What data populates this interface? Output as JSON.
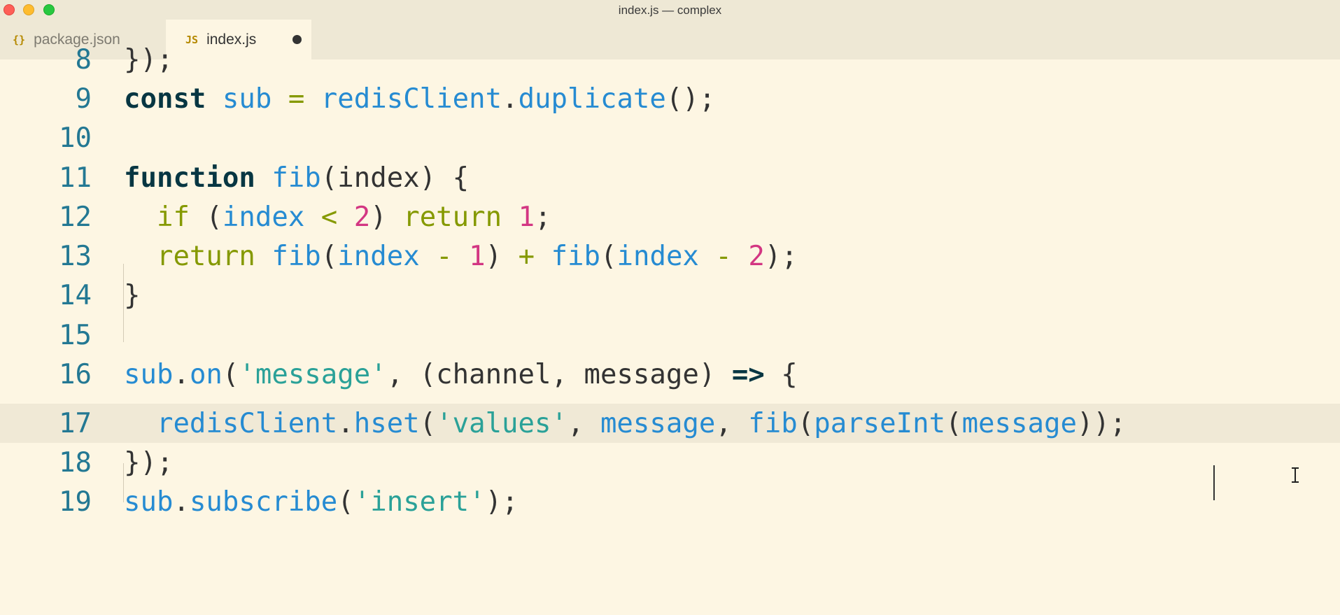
{
  "window": {
    "title": "index.js — complex"
  },
  "tabs": [
    {
      "label": "package.json",
      "icon": "{}",
      "active": false,
      "dirty": false
    },
    {
      "label": "index.js",
      "icon": "JS",
      "active": true,
      "dirty": true
    }
  ],
  "editor": {
    "current_line": 17,
    "lines": [
      {
        "number": "8",
        "text": "});"
      },
      {
        "number": "9",
        "text": "const sub = redisClient.duplicate();"
      },
      {
        "number": "10",
        "text": ""
      },
      {
        "number": "11",
        "text": "function fib(index) {"
      },
      {
        "number": "12",
        "text": "  if (index < 2) return 1;"
      },
      {
        "number": "13",
        "text": "  return fib(index - 1) + fib(index - 2);"
      },
      {
        "number": "14",
        "text": "}"
      },
      {
        "number": "15",
        "text": ""
      },
      {
        "number": "16",
        "text": "sub.on('message', (channel, message) => {"
      },
      {
        "number": "17",
        "text": "  redisClient.hset('values', message, fib(parseInt(message)));"
      },
      {
        "number": "18",
        "text": "});"
      },
      {
        "number": "19",
        "text": "sub.subscribe('insert');"
      }
    ]
  },
  "colors": {
    "background": "#fdf6e3",
    "line_number": "#237893",
    "identifier": "#268bd2",
    "keyword_control": "#859900",
    "number": "#d33682",
    "string": "#2aa198"
  }
}
